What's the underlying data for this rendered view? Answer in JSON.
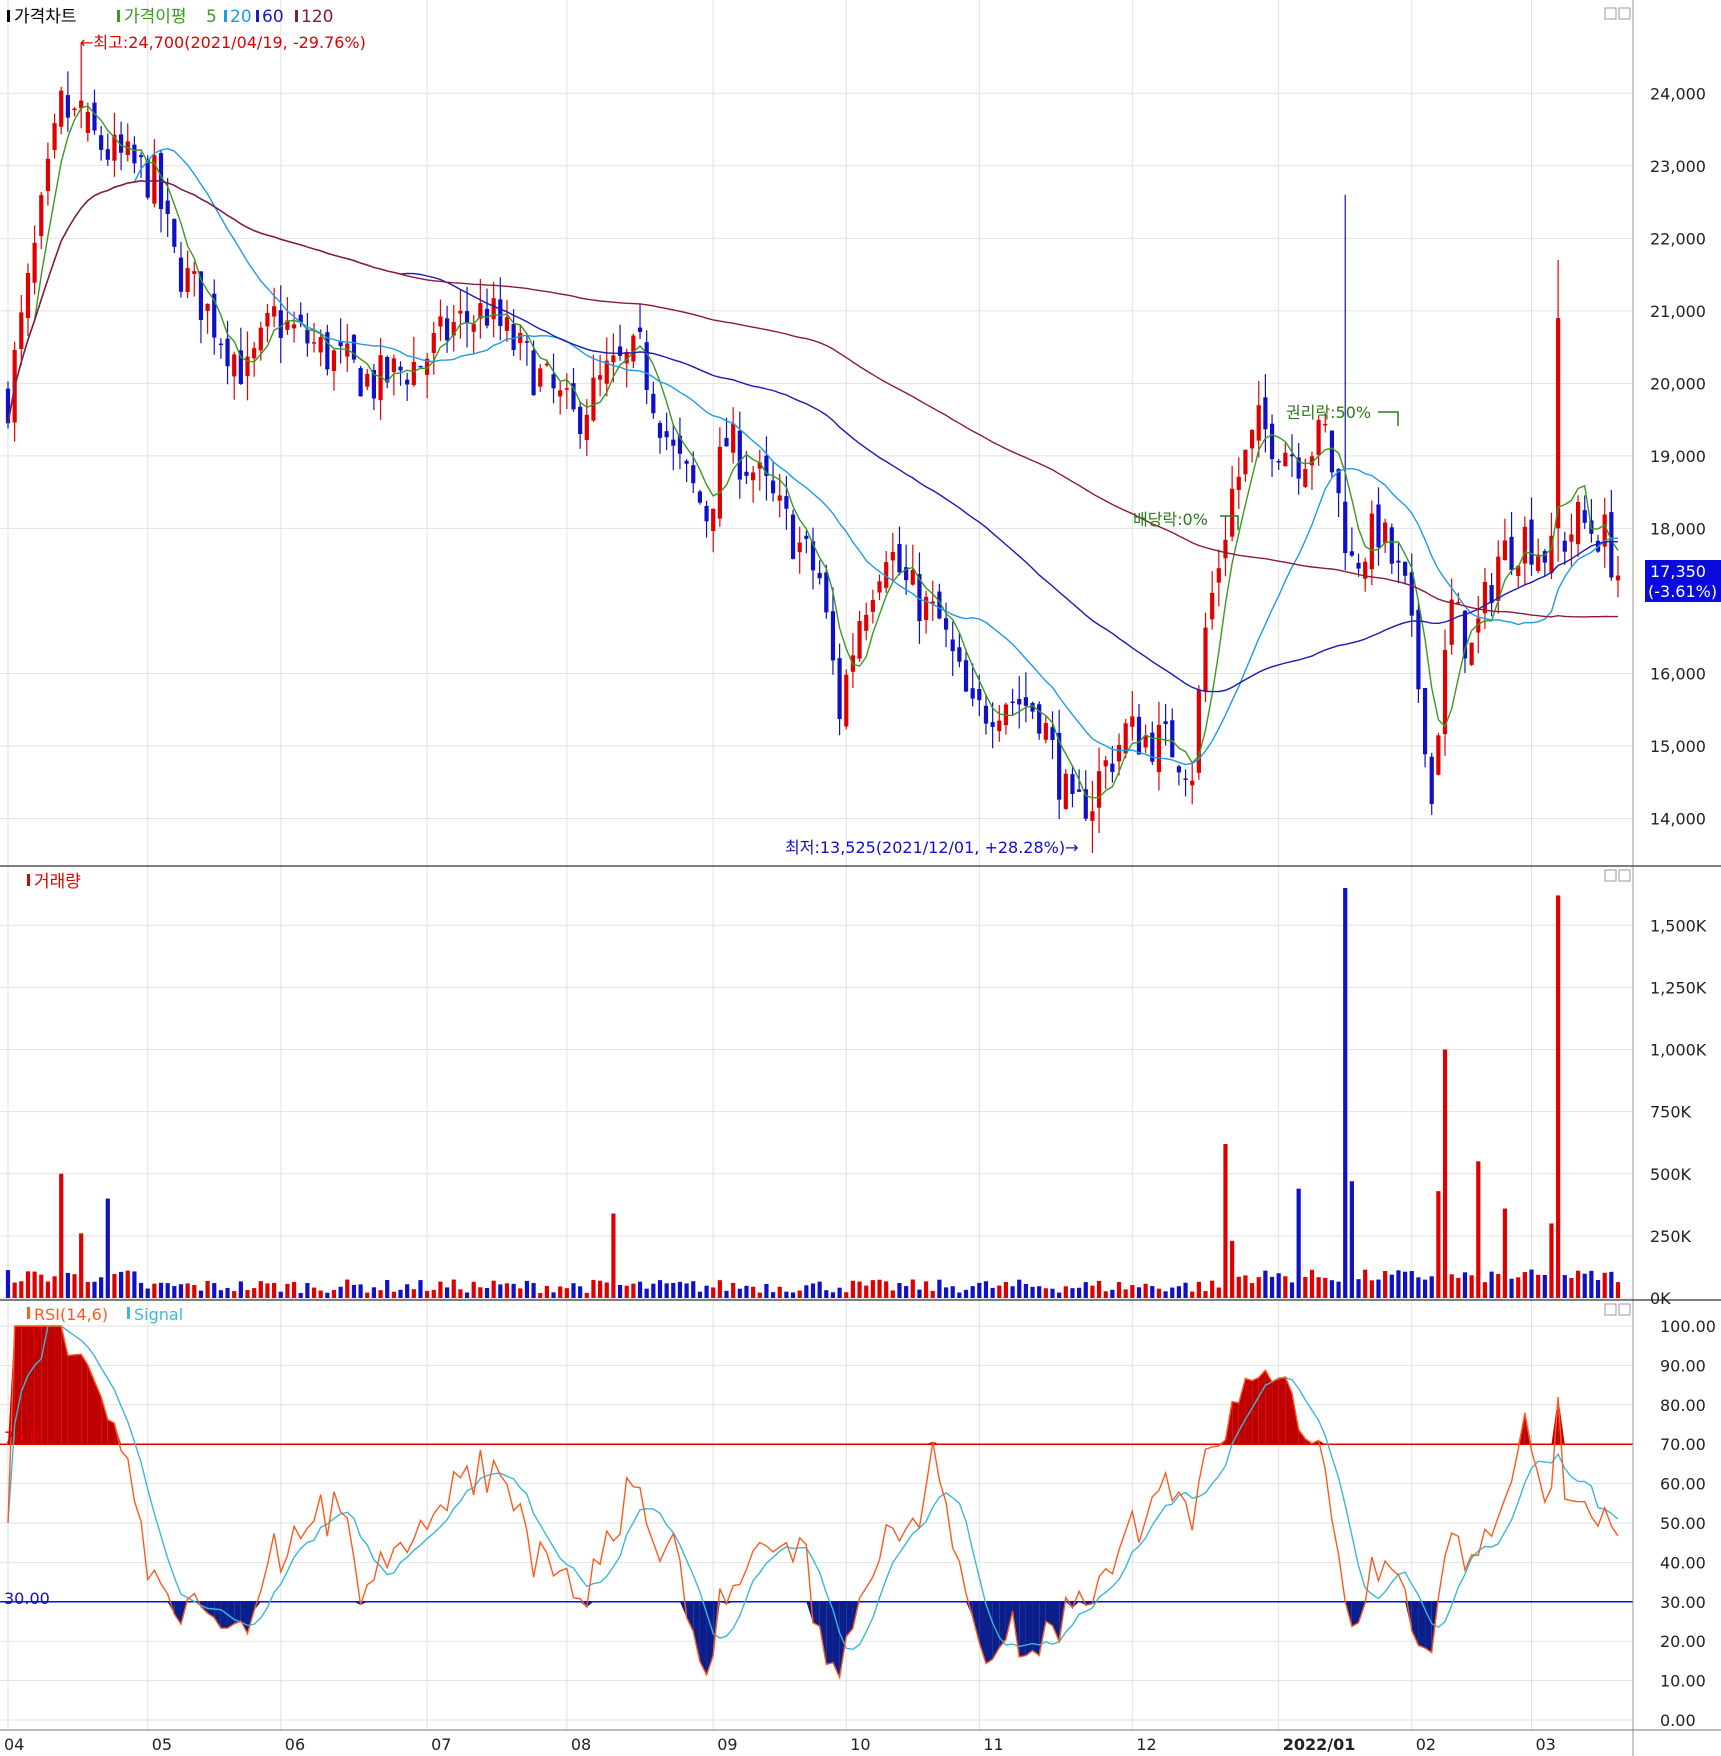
{
  "price_panel": {
    "legend": {
      "title": "가격차트",
      "ma_label": "가격이평",
      "ma_periods": [
        "5",
        "20",
        "60",
        "120"
      ],
      "ma_colors": [
        "#3a9a1e",
        "#1e9be8",
        "#1a1ab4",
        "#8b1a3a"
      ]
    },
    "high_annotation": "←최고:24,700(2021/04/19, -29.76%)",
    "low_annotation": "최저:13,525(2021/12/01, +28.28%)→",
    "dividend_annotation": "배당락:0%",
    "rights_annotation": "권리락:50%",
    "current_price": "17,350",
    "current_change": "(-3.61%)",
    "y_ticks": [
      "24,000",
      "23,000",
      "22,000",
      "21,000",
      "20,000",
      "19,000",
      "18,000",
      "16,000",
      "15,000",
      "14,000"
    ]
  },
  "volume_panel": {
    "title": "거래량",
    "y_ticks": [
      "1,500K",
      "1,250K",
      "1,000K",
      "750K",
      "500K",
      "250K",
      "0K"
    ]
  },
  "rsi_panel": {
    "title": "RSI(14,6)",
    "signal_label": "Signal",
    "upper_line_label": "70.0",
    "lower_line_label": "30.00",
    "y_ticks": [
      "100.00",
      "90.00",
      "80.00",
      "70.00",
      "60.00",
      "50.00",
      "40.00",
      "30.00",
      "20.00",
      "10.00",
      "0.00"
    ]
  },
  "x_axis": {
    "labels": [
      "04",
      "05",
      "06",
      "07",
      "08",
      "09",
      "10",
      "11",
      "12",
      "2022/01",
      "02",
      "03"
    ]
  },
  "colors": {
    "up": "#e00000",
    "down": "#1010c8",
    "rsi": "#ff5a1e",
    "signal": "#3ab8d8"
  },
  "chart_data": {
    "type": "candlestick",
    "price": {
      "ylim": [
        13400,
        24900
      ],
      "high": 24700,
      "low": 13525,
      "last_close": 17350,
      "monthly_path": [
        [
          0,
          19.8
        ],
        [
          8,
          23.8
        ],
        [
          15,
          23.2
        ],
        [
          22,
          22.8
        ],
        [
          25,
          21.7
        ],
        [
          30,
          21.0
        ],
        [
          36,
          20.1
        ],
        [
          40,
          20.9
        ],
        [
          48,
          20.4
        ],
        [
          55,
          20.0
        ],
        [
          62,
          20.3
        ],
        [
          67,
          20.8
        ],
        [
          72,
          21.0
        ],
        [
          78,
          20.3
        ],
        [
          85,
          19.5
        ],
        [
          90,
          20.1
        ],
        [
          95,
          20.4
        ],
        [
          100,
          19.0
        ],
        [
          105,
          18.2
        ],
        [
          108,
          19.2
        ],
        [
          112,
          18.8
        ],
        [
          118,
          17.9
        ],
        [
          122,
          17.3
        ],
        [
          125,
          15.5
        ],
        [
          128,
          16.8
        ],
        [
          132,
          17.8
        ],
        [
          135,
          17.2
        ],
        [
          140,
          16.7
        ],
        [
          145,
          15.4
        ],
        [
          150,
          15.7
        ],
        [
          155,
          15.5
        ],
        [
          160,
          14.0
        ],
        [
          163,
          14.4
        ],
        [
          168,
          15.2
        ],
        [
          175,
          15.0
        ],
        [
          178,
          14.7
        ],
        [
          180,
          16.6
        ],
        [
          184,
          18.5
        ],
        [
          188,
          19.4
        ],
        [
          194,
          19.0
        ],
        [
          198,
          19.3
        ],
        [
          202,
          17.5
        ],
        [
          206,
          18.0
        ],
        [
          210,
          17.1
        ],
        [
          214,
          14.6
        ],
        [
          217,
          16.9
        ],
        [
          220,
          16.3
        ],
        [
          224,
          17.6
        ],
        [
          228,
          17.9
        ],
        [
          232,
          17.6
        ],
        [
          236,
          18.1
        ],
        [
          240,
          17.9
        ],
        [
          242,
          17.35
        ]
      ]
    },
    "volume": {
      "ylim": [
        0,
        1650
      ],
      "unit": "K",
      "spikes": [
        [
          8,
          500
        ],
        [
          11,
          260
        ],
        [
          15,
          400
        ],
        [
          91,
          340
        ],
        [
          183,
          620
        ],
        [
          184,
          230
        ],
        [
          194,
          440
        ],
        [
          201,
          1650
        ],
        [
          202,
          470
        ],
        [
          216,
          1000
        ],
        [
          215,
          430
        ],
        [
          221,
          550
        ],
        [
          225,
          360
        ],
        [
          233,
          1620
        ],
        [
          232,
          300
        ]
      ]
    },
    "rsi": {
      "ylim": [
        0,
        100
      ],
      "upper": 70,
      "lower": 30,
      "period": 14,
      "signal_period": 6
    }
  }
}
